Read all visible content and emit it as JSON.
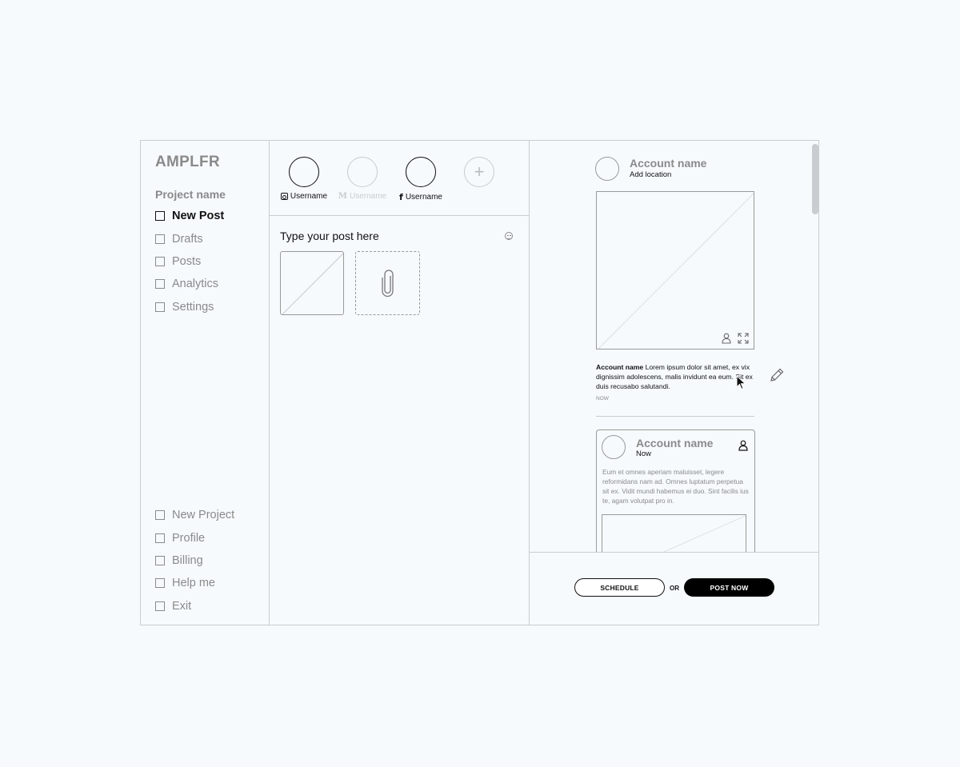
{
  "app": {
    "logo": "AMPLFR",
    "project_name": "Project name"
  },
  "sidebar": {
    "top_items": [
      {
        "label": "New Post",
        "active": true
      },
      {
        "label": "Drafts"
      },
      {
        "label": "Posts"
      },
      {
        "label": "Analytics"
      },
      {
        "label": "Settings"
      }
    ],
    "bottom_items": [
      {
        "label": "New Project"
      },
      {
        "label": "Profile"
      },
      {
        "label": "Billing"
      },
      {
        "label": "Help me"
      },
      {
        "label": "Exit"
      }
    ]
  },
  "accounts": [
    {
      "username": "Username",
      "network_icon": "instagram-icon",
      "selected": true
    },
    {
      "username": "Username",
      "network_icon": "medium-icon",
      "selected": false
    },
    {
      "username": "Username",
      "network_icon": "facebook-icon",
      "selected": true
    }
  ],
  "composer": {
    "placeholder": "Type your post here"
  },
  "preview": {
    "account_name": "Account name",
    "location": "Add location",
    "caption_account": "Account name",
    "caption_text": " Lorem ipsum dolor sit amet, ex vix dignissim adolescens, malis invidunt ea eum. Sit ex duis recusabo salutandi.",
    "timestamp": "NOW",
    "card2": {
      "account_name": "Account name",
      "time": "Now",
      "text": "Eum et omnes aperiam maluisset, legere reformidans nam ad. Omnes luptatum perpetua sit ex. Vidit mundi habemus ei duo. Sint facilis ius te, agam volutpat pro in."
    }
  },
  "actions": {
    "schedule": "SCHEDULE",
    "or": "OR",
    "post_now": "POST NOW"
  }
}
